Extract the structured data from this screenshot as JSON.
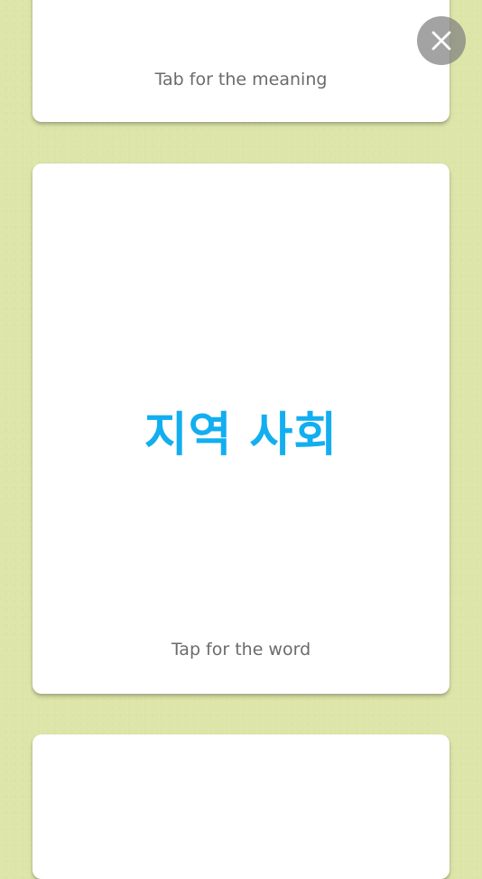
{
  "cards": {
    "top": {
      "hint": "Tab for the meaning"
    },
    "middle": {
      "word": "지역 사회",
      "hint": "Tap for the word"
    },
    "bottom": {
      "hint": ""
    }
  },
  "icons": {
    "close": "close-icon"
  },
  "colors": {
    "background": "#dde5a9",
    "word": "#12aef0",
    "hint": "#6b6b6b",
    "close_button": "#808080"
  }
}
